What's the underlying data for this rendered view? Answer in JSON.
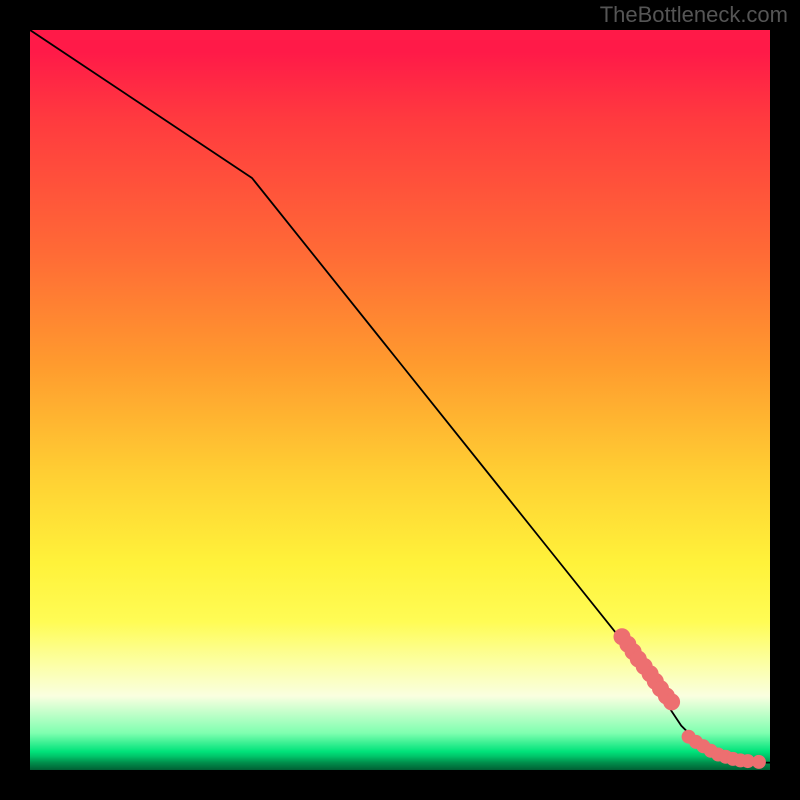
{
  "watermark": "TheBottleneck.com",
  "chart_data": {
    "type": "line",
    "title": "",
    "xlabel": "",
    "ylabel": "",
    "xlim": [
      0,
      100
    ],
    "ylim": [
      0,
      100
    ],
    "grid": false,
    "legend": false,
    "series": [
      {
        "name": "curve",
        "kind": "line",
        "x": [
          0,
          15,
          30,
          50,
          70,
          82,
          88,
          92,
          95,
          100
        ],
        "y": [
          100,
          90,
          80,
          55,
          30,
          15,
          6,
          2,
          1,
          1
        ]
      },
      {
        "name": "points-upper-cluster",
        "kind": "scatter",
        "x": [
          80,
          80.8,
          81.5,
          82.2,
          83,
          83.8,
          84.5,
          85.2,
          86,
          86.7
        ],
        "y": [
          18,
          17,
          16,
          15,
          14,
          13,
          12,
          11,
          10,
          9.2
        ]
      },
      {
        "name": "points-lower-cluster",
        "kind": "scatter",
        "x": [
          89,
          90,
          91,
          92,
          93,
          94,
          95,
          96,
          97,
          98.5
        ],
        "y": [
          4.5,
          3.8,
          3.2,
          2.6,
          2.1,
          1.8,
          1.5,
          1.3,
          1.2,
          1.1
        ]
      }
    ]
  }
}
